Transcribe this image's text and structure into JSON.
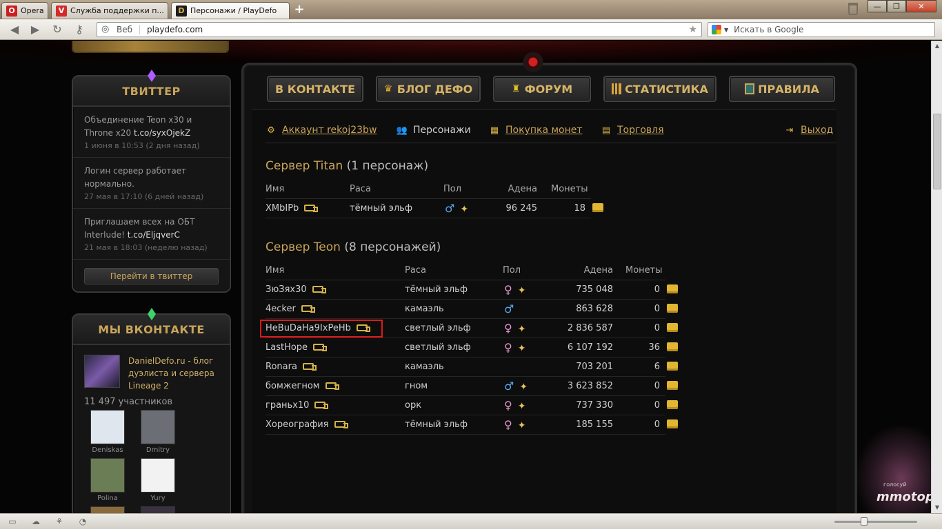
{
  "browser": {
    "tabs": [
      {
        "label": "Opera"
      },
      {
        "label": "Служба поддержки п..."
      },
      {
        "label": "Персонажи / PlayDefo"
      }
    ],
    "address": {
      "prefix": "Веб",
      "url": "playdefo.com"
    },
    "search": {
      "placeholder": "Искать в Google"
    }
  },
  "twitter": {
    "title": "ТВИТТЕР",
    "tweets": [
      {
        "text": "Объединение Teon x30 и Throne x20 ",
        "link": "t.co/syxOjekZ",
        "time": "1 июня в 10:53 (2 дня назад)"
      },
      {
        "text": "Логин сервер работает нормально.",
        "link": "",
        "time": "27 мая в 17:10 (6 дней назад)"
      },
      {
        "text": "Приглашаем всех на ОБТ Interlude! ",
        "link": "t.co/EljqverC",
        "time": "21 мая в 18:03 (неделю назад)"
      }
    ],
    "button": "Перейти в твиттер"
  },
  "vk": {
    "title": "МЫ ВКОНТАКТЕ",
    "group_name": "DanielDefo.ru - блог дуэлиста и сервера Lineage 2",
    "members": "11 497 участников",
    "users": [
      {
        "name": "Deniskas",
        "color": "#dfe6ee"
      },
      {
        "name": "Dmitry",
        "color": "#6b6e74"
      },
      {
        "name": "Polina",
        "color": "#6a7d54"
      },
      {
        "name": "Yury",
        "color": "#f2f2f2"
      },
      {
        "name": "Alexey",
        "color": "#8a6a3a"
      },
      {
        "name": "Max",
        "color": "#3a3140"
      }
    ]
  },
  "topnav": [
    {
      "label": "В КОНТАКТЕ",
      "icon": ""
    },
    {
      "label": "БЛОГ ДЕФО",
      "icon": "crown-icon"
    },
    {
      "label": "ФОРУМ",
      "icon": "castle-icon"
    },
    {
      "label": "СТАТИСТИКА",
      "icon": "chart-icon"
    },
    {
      "label": "ПРАВИЛА",
      "icon": "rules-icon"
    }
  ],
  "subnav": {
    "account": "Аккаунт rekoj23bw",
    "characters": "Персонажи",
    "buy_coins": "Покупка монет",
    "trade": "Торговля",
    "logout": "Выход"
  },
  "columns": {
    "name": "Имя",
    "race": "Раса",
    "sex": "Пол",
    "adena": "Адена",
    "coins": "Монеты"
  },
  "servers": [
    {
      "name": "Сервер Titan",
      "count": "(1 персонаж)",
      "characters": [
        {
          "name": "XMbIPb",
          "race": "тёмный эльф",
          "sex": "male",
          "mage": true,
          "adena": "96 245",
          "coins": "18"
        }
      ]
    },
    {
      "name": "Сервер Teon",
      "count": "(8 персонажей)",
      "characters": [
        {
          "name": "ЗюЗях30",
          "race": "тёмный эльф",
          "sex": "female",
          "mage": true,
          "adena": "735 048",
          "coins": "0"
        },
        {
          "name": "4ecker",
          "race": "камаэль",
          "sex": "male",
          "mage": false,
          "adena": "863 628",
          "coins": "0"
        },
        {
          "name": "HeBuDaHa9IxPeHb",
          "race": "светлый эльф",
          "sex": "female",
          "mage": true,
          "adena": "2 836 587",
          "coins": "0",
          "highlighted": true
        },
        {
          "name": "LastHope",
          "race": "светлый эльф",
          "sex": "female",
          "mage": true,
          "adena": "6 107 192",
          "coins": "36"
        },
        {
          "name": "Ronara",
          "race": "камаэль",
          "sex": "",
          "mage": false,
          "adena": "703 201",
          "coins": "6"
        },
        {
          "name": "бомжегном",
          "race": "гном",
          "sex": "male",
          "mage": true,
          "adena": "3 623 852",
          "coins": "0"
        },
        {
          "name": "граньх10",
          "race": "орк",
          "sex": "female",
          "mage": true,
          "adena": "737 330",
          "coins": "0"
        },
        {
          "name": "Хореография",
          "race": "тёмный эльф",
          "sex": "female",
          "mage": true,
          "adena": "185 155",
          "coins": "0"
        }
      ]
    }
  ],
  "deco": {
    "vote_small": "голосуй",
    "vote_big": "mmotop"
  }
}
